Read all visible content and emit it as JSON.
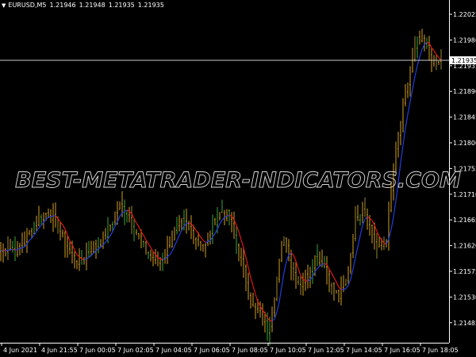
{
  "header": {
    "symbol_tf": "EURUSD,M5",
    "open": "1.21946",
    "high": "1.21948",
    "low": "1.21935",
    "close": "1.21935"
  },
  "watermark": "BEST-METATRADER-INDICATORS.COM",
  "current_price": "1.21935",
  "colors": {
    "background": "#000000",
    "axis": "#ffffff",
    "bull_bar": "#d4a020",
    "bear_bar": "#d4a020",
    "ma_up": "#1f3fe0",
    "ma_down": "#e01818",
    "price_line": "#c8c8c8"
  },
  "chart_data": {
    "type": "ohlc-bars-with-colored-ma",
    "symbol": "EURUSD",
    "timeframe": "M5",
    "y_ticks": [
      "1.22025",
      "1.21980",
      "1.21935",
      "1.21890",
      "1.21845",
      "1.21800",
      "1.21755",
      "1.21710",
      "1.21665",
      "1.21620",
      "1.21575",
      "1.21530",
      "1.21485"
    ],
    "ylim": [
      1.2145,
      1.2205
    ],
    "x_ticks": [
      "4 Jun 2021",
      "4 Jun 21:55",
      "7 Jun 00:05",
      "7 Jun 02:05",
      "7 Jun 04:05",
      "7 Jun 06:05",
      "7 Jun 08:05",
      "7 Jun 10:05",
      "7 Jun 12:05",
      "7 Jun 14:05",
      "7 Jun 16:05",
      "7 Jun 18:05"
    ],
    "close_path": [
      1.2161,
      1.2162,
      1.2161,
      1.2163,
      1.2165,
      1.2167,
      1.2168,
      1.2166,
      1.2163,
      1.216,
      1.2159,
      1.2161,
      1.2162,
      1.2163,
      1.2166,
      1.2169,
      1.2168,
      1.2165,
      1.2162,
      1.216,
      1.2159,
      1.2161,
      1.2164,
      1.2166,
      1.2165,
      1.2163,
      1.2162,
      1.2166,
      1.2168,
      1.2167,
      1.2162,
      1.2157,
      1.2151,
      1.215,
      1.2147,
      1.2155,
      1.2164,
      1.2158,
      1.2155,
      1.2157,
      1.216,
      1.2159,
      1.2155,
      1.2153,
      1.2156,
      1.2166,
      1.2169,
      1.2165,
      1.2161,
      1.2163,
      1.2176,
      1.2185,
      1.2192,
      1.2198,
      1.2197,
      1.2194,
      1.2194
    ]
  }
}
